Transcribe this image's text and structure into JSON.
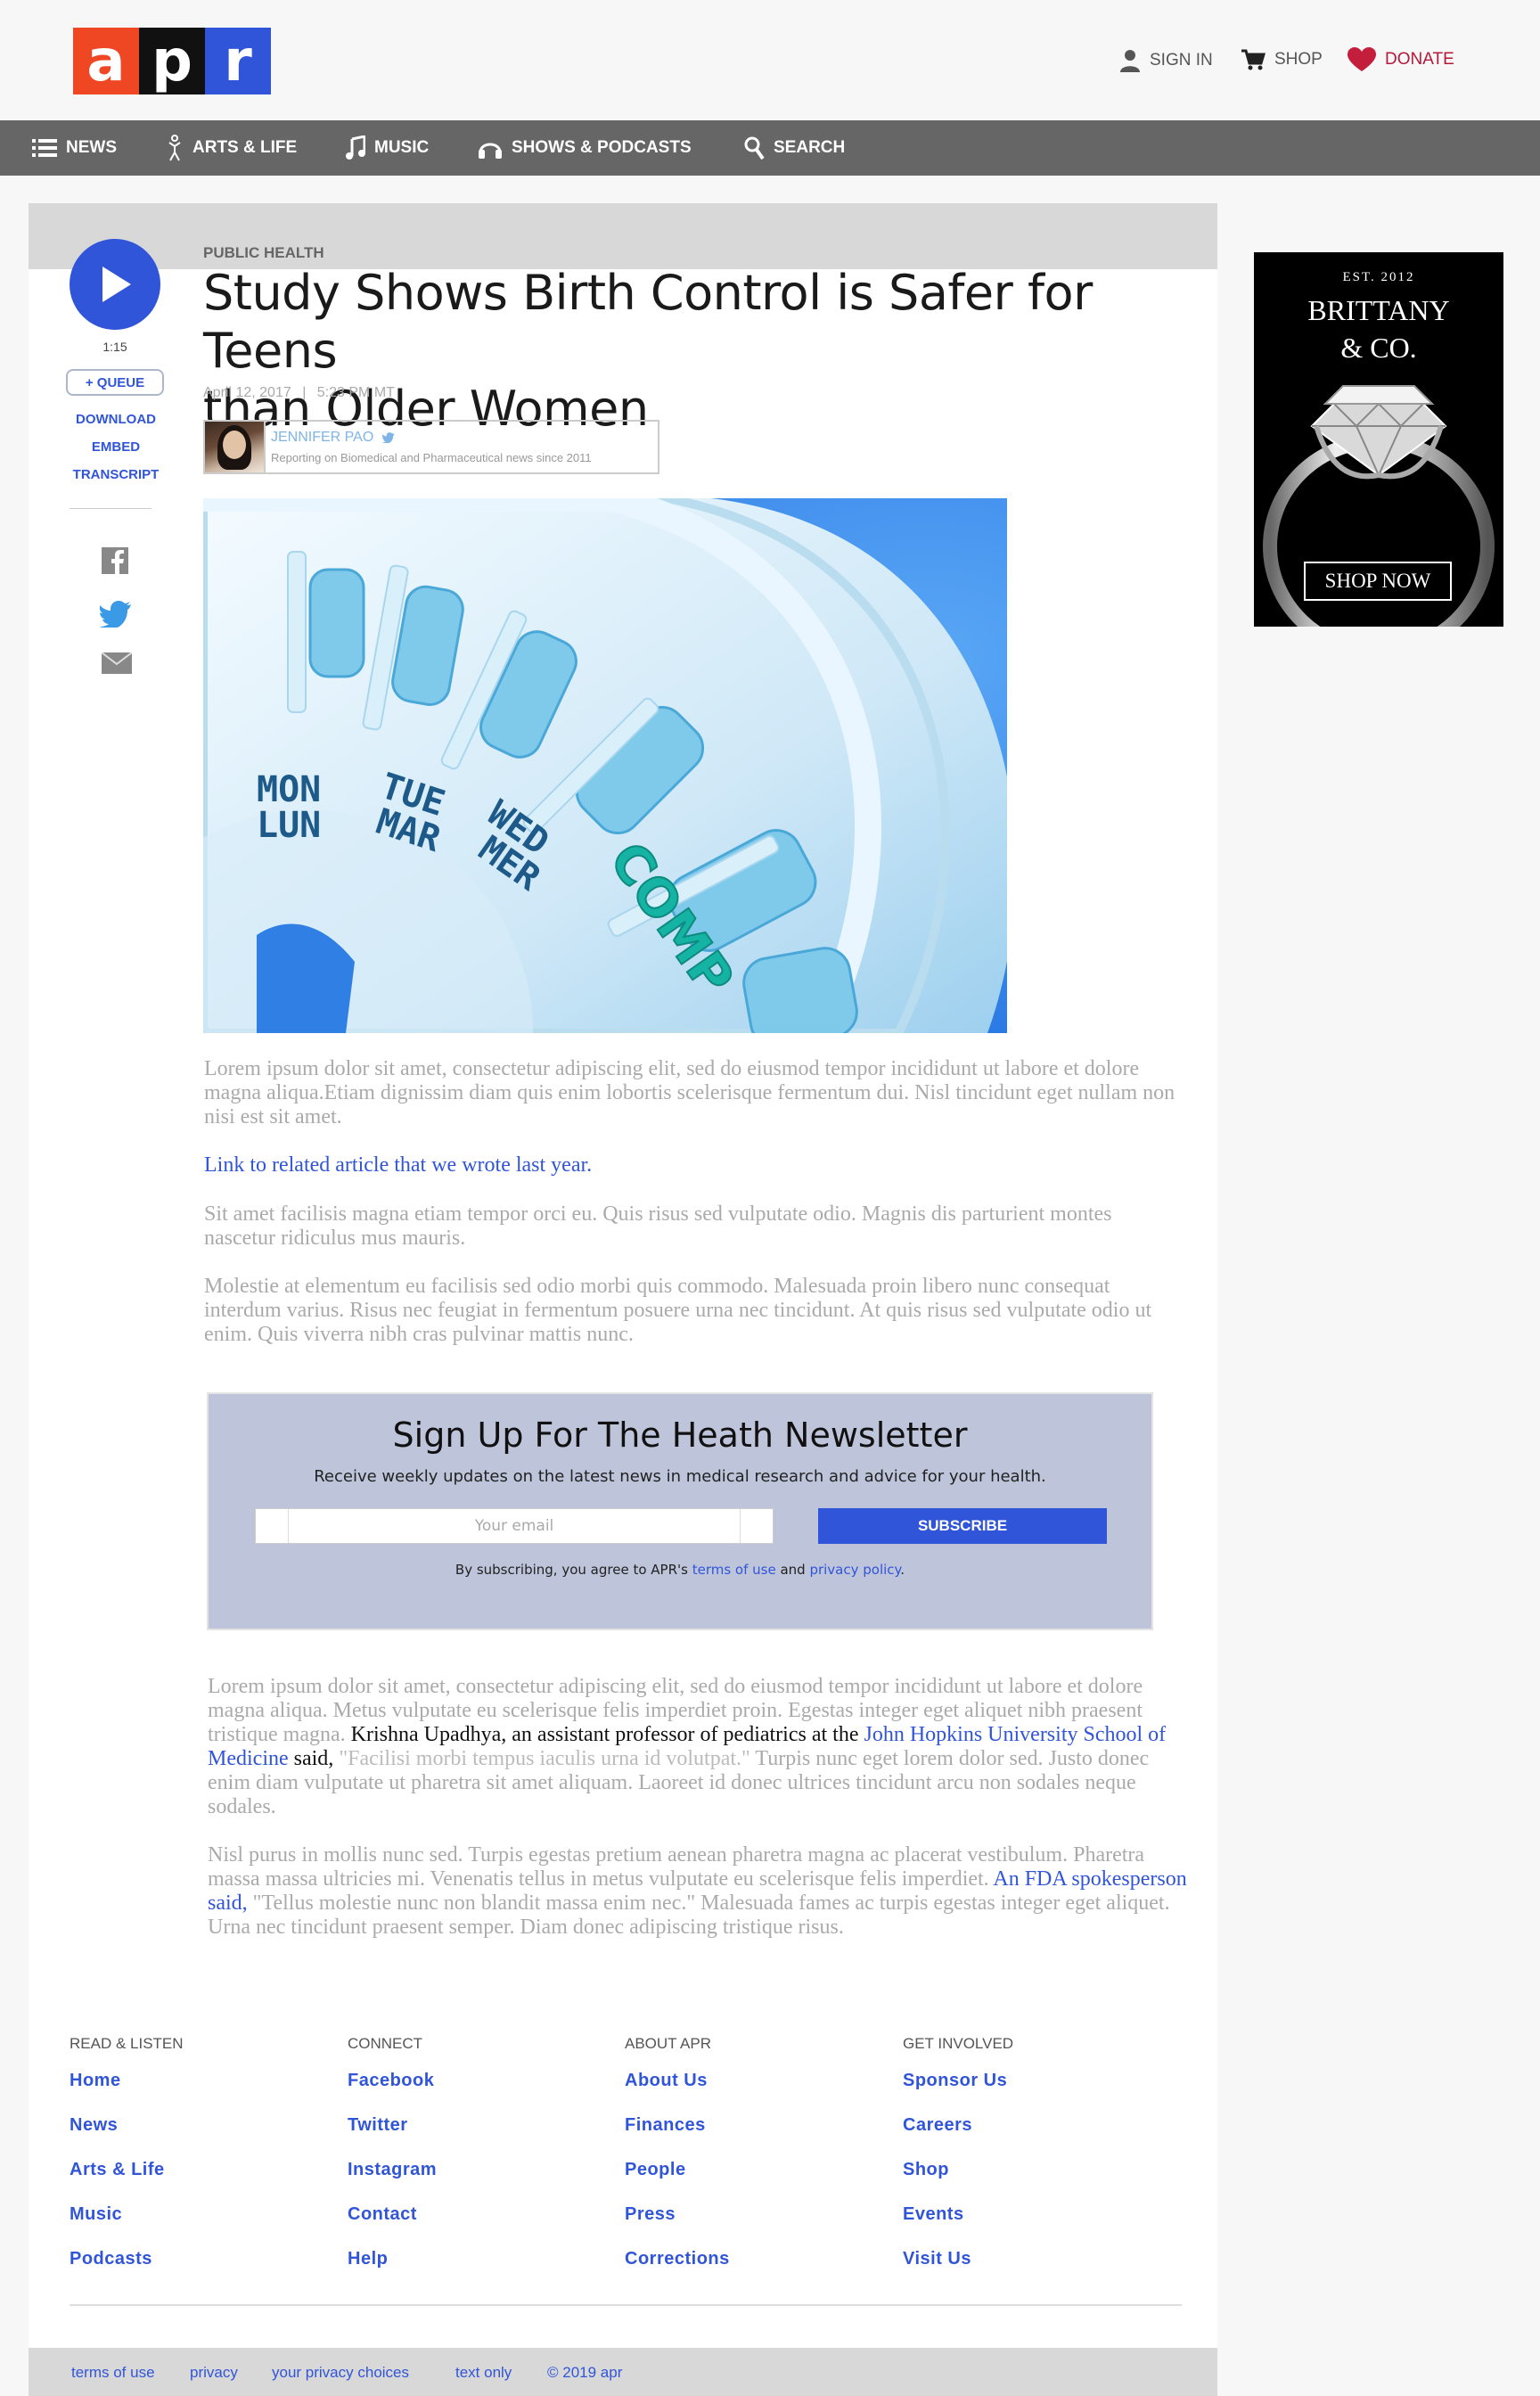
{
  "header": {
    "logo_letters": [
      "a",
      "p",
      "r"
    ],
    "utility": {
      "sign_in": "SIGN IN",
      "shop": "SHOP",
      "donate": "DONATE"
    }
  },
  "nav": {
    "news": "NEWS",
    "arts": "ARTS & LIFE",
    "music": "MUSIC",
    "shows": "SHOWS & PODCASTS",
    "search": "SEARCH"
  },
  "player": {
    "duration": "1:15",
    "queue": "+ QUEUE",
    "download": "DOWNLOAD",
    "embed": "EMBED",
    "transcript": "TRANSCRIPT"
  },
  "article": {
    "section": "PUBLIC HEALTH",
    "title_line1": "Study Shows Birth Control is Safer for Teens",
    "title_line2": "than Older Women",
    "date": "April 12, 2017",
    "time": "5:23 PM MT",
    "author": "JENNIFER PAO",
    "author_bio": "Reporting on Biomedical and Pharmaceutical news since 2011",
    "hero_text": [
      "MON",
      "LUN",
      "TUE",
      "MAR",
      "WED",
      "MER",
      "COMP"
    ],
    "p1": "Lorem ipsum dolor sit amet, consectetur adipiscing elit, sed do eiusmod tempor incididunt ut labore et dolore magna aliqua.Etiam dignissim diam quis enim lobortis scelerisque fermentum dui. Nisl tincidunt eget nullam non nisi est sit amet.",
    "related_link": "Link to related article that we wrote last year.",
    "p2": "Sit amet facilisis magna etiam tempor orci eu. Quis risus sed vulputate odio. Magnis dis parturient montes nascetur ridiculus mus mauris.",
    "p3": "Molestie at elementum eu facilisis sed odio morbi quis commodo. Malesuada proin libero nunc consequat interdum varius. Risus nec feugiat in fermentum posuere urna nec tincidunt. At quis risus sed vulputate odio ut enim. Quis viverra nibh cras pulvinar mattis nunc.",
    "p4_a": "Lorem ipsum dolor sit amet, consectetur adipiscing elit, sed do eiusmod tempor incididunt ut labore et dolore magna aliqua. Metus vulputate eu scelerisque felis imperdiet proin. Egestas integer eget aliquet nibh praesent tristique magna.",
    "p4_b": " Krishna Upadhya, an assistant professor of pediatrics at the ",
    "p4_link": "John Hopkins University School of Medicine",
    "p4_c": " said,",
    "p4_d": " \"Facilisi morbi tempus iaculis urna id volutpat.\"",
    "p4_e": " Turpis nunc eget lorem dolor sed.  Justo donec enim diam vulputate ut pharetra sit amet aliquam. Laoreet id donec ultrices tincidunt arcu non sodales neque sodales.",
    "p5_a": "Nisl purus in mollis nunc sed. Turpis egestas pretium aenean pharetra magna ac placerat vestibulum. Pharetra massa massa ultricies mi. Venenatis tellus in metus vulputate eu scelerisque felis imperdiet. ",
    "p5_link": "An FDA spokesperson said,",
    "p5_b": " \"Tellus molestie nunc non blandit massa enim nec.\" Malesuada fames ac turpis egestas integer eget aliquet. Urna nec tincidunt praesent semper. Diam donec adipiscing tristique risus."
  },
  "newsletter": {
    "title": "Sign Up For The Heath Newsletter",
    "subtitle": "Receive weekly updates on the latest news in medical research and advice for your health.",
    "placeholder": "Your email",
    "button": "SUBSCRIBE",
    "terms_a": "By subscribing, you agree to APR's ",
    "terms_link1": "terms of use",
    "terms_b": " and ",
    "terms_link2": "privacy policy",
    "terms_c": "."
  },
  "ad": {
    "est": "EST. 2012",
    "brand_line1": "BRITTANY",
    "brand_line2": "& CO.",
    "cta": "SHOP NOW"
  },
  "footer": {
    "columns": [
      {
        "heading": "READ & LISTEN",
        "links": [
          "Home",
          "News",
          "Arts & Life",
          "Music",
          "Podcasts"
        ]
      },
      {
        "heading": "CONNECT",
        "links": [
          "Facebook",
          "Twitter",
          "Instagram",
          "Contact",
          "Help"
        ]
      },
      {
        "heading": "ABOUT APR",
        "links": [
          "About Us",
          "Finances",
          "People",
          "Press",
          "Corrections"
        ]
      },
      {
        "heading": "GET INVOLVED",
        "links": [
          "Sponsor Us",
          "Careers",
          "Shop",
          "Events",
          "Visit Us"
        ]
      }
    ],
    "legal": [
      "terms of use",
      "privacy",
      "your privacy choices",
      "text only",
      "© 2019 apr"
    ]
  },
  "colors": {
    "brand_blue": "#3155d8",
    "brand_orange": "#ef4723",
    "donate_red": "#b5183a",
    "nav_gray": "#666666"
  }
}
